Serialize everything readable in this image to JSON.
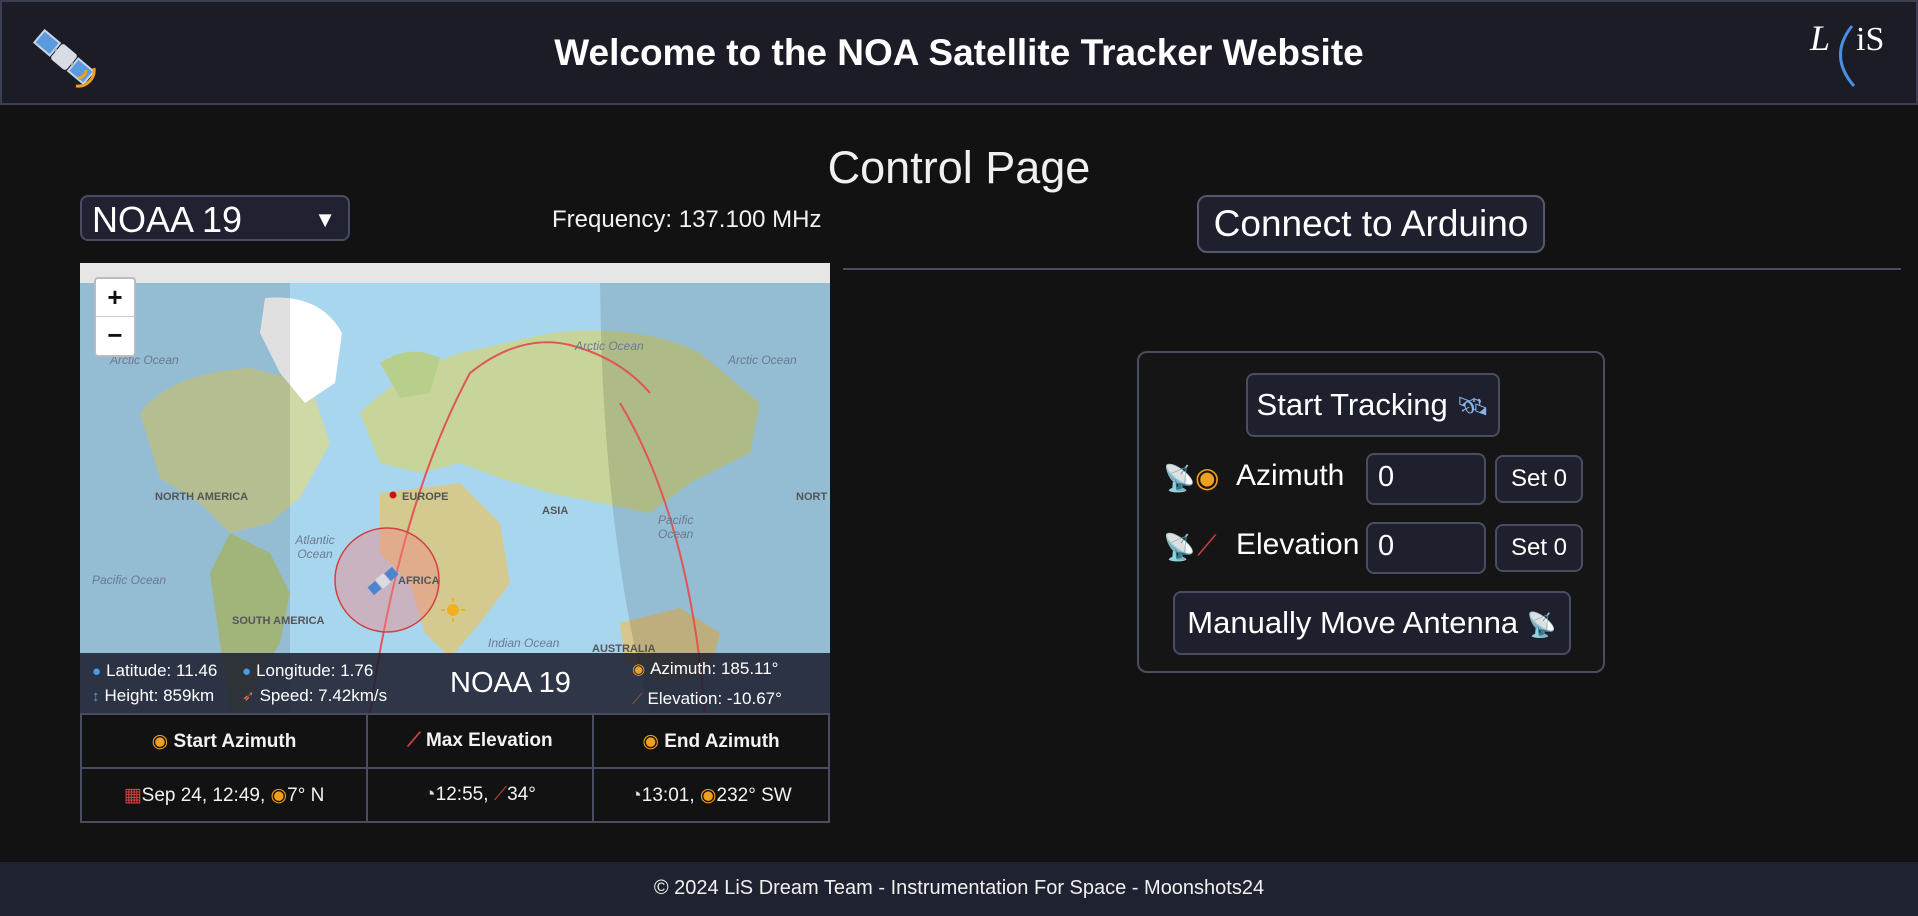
{
  "header": {
    "title": "Welcome to the NOA Satellite Tracker Website",
    "logo_icon": "satellite-icon",
    "brand_logo_text": "LiS"
  },
  "page_title": "Control Page",
  "satellite_select": {
    "selected": "NOAA 19",
    "arrow": "▼"
  },
  "frequency": "Frequency: 137.100 MHz",
  "map": {
    "zoom_in": "+",
    "zoom_out": "−",
    "labels": {
      "arctic_ocean_1": "Arctic Ocean",
      "arctic_ocean_2": "Arctic Ocean",
      "arctic_ocean_3": "Arctic Ocean",
      "north_america": "NORTH AMERICA",
      "europe": "EUROPE",
      "asia": "ASIA",
      "atlantic_ocean": "Atlantic Ocean",
      "pacific_ocean_1": "Pacific Ocean",
      "pacific_ocean_2": "Pacific Ocean",
      "africa": "AFRICA",
      "south_america": "SOUTH AMERICA",
      "indian_ocean": "Indian Ocean",
      "australia": "AUSTRALIA",
      "north_truncated": "NORT"
    },
    "info": {
      "latitude": "Latitude: 11.46",
      "longitude": "Longitude: 1.76",
      "height": "Height: 859km",
      "speed": "Speed: 7.42km/s",
      "satellite_name": "NOAA 19",
      "azimuth": "Azimuth: 185.11°",
      "elevation": "Elevation: -10.67°"
    }
  },
  "pass_table": {
    "headers": [
      "Start Azimuth",
      "Max Elevation",
      "End Azimuth"
    ],
    "row": [
      "Sep 24, 12:49,",
      "7° N",
      "12:55,",
      "34°",
      "13:01,",
      "232° SW"
    ]
  },
  "connect_button": "Connect to Arduino",
  "controls": {
    "start_tracking": "Start Tracking",
    "azimuth_label": "Azimuth",
    "azimuth_value": "0",
    "elevation_label": "Elevation",
    "elevation_value": "0",
    "set_zero": "Set 0",
    "manual_move": "Manually Move Antenna"
  },
  "footer": "© 2024 LiS Dream Team - Instrumentation For Space - Moonshots24",
  "colors": {
    "background": "#121212",
    "header": "#1c1c27",
    "border": "#4a4c62",
    "track": "#e05555"
  }
}
